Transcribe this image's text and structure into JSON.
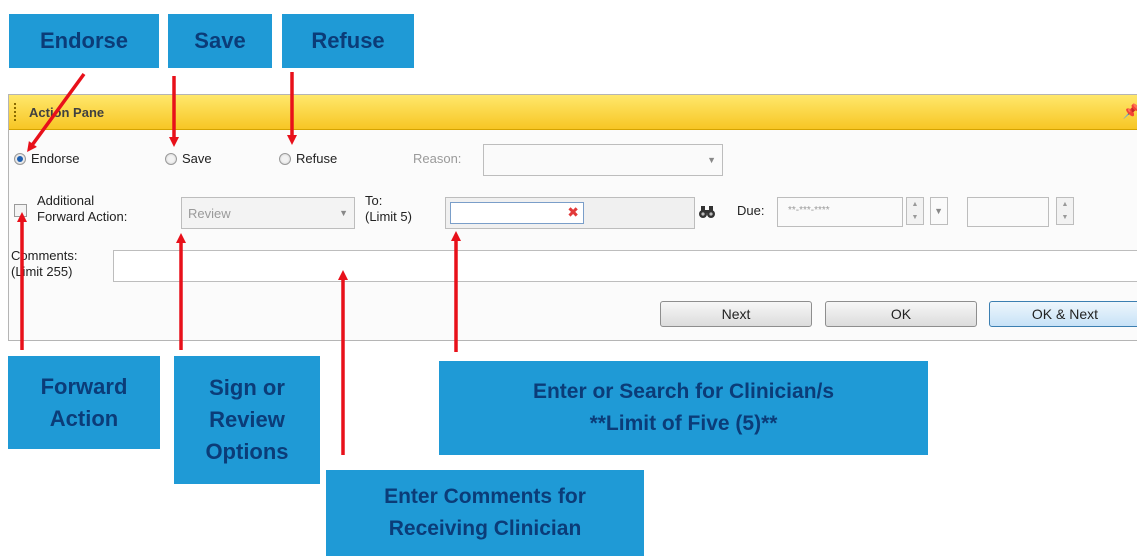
{
  "callouts": {
    "endorse": "Endorse",
    "save": "Save",
    "refuse": "Refuse",
    "forward_action": [
      "Forward",
      "Action"
    ],
    "sign_review": [
      "Sign or",
      "Review",
      "Options"
    ],
    "search_clinician": [
      "Enter or Search for Clinician/s",
      "**Limit of Five (5)**"
    ],
    "comments": [
      "Enter Comments for",
      "Receiving Clinician"
    ]
  },
  "pane": {
    "title": "Action Pane",
    "radios": {
      "endorse": "Endorse",
      "save": "Save",
      "refuse": "Refuse",
      "selected": "endorse"
    },
    "reason_label": "Reason:",
    "reason_value": "",
    "additional_label": [
      "Additional",
      "Forward Action:"
    ],
    "forward_action_value": "Review",
    "to_label": [
      "To:",
      "(Limit 5)"
    ],
    "to_value": "",
    "due_label": "Due:",
    "due_placeholder": "**-***-****",
    "comments_label": [
      "Comments:",
      "(Limit 255)"
    ],
    "comments_value": "",
    "buttons": {
      "next": "Next",
      "ok": "OK",
      "ok_next": "OK & Next"
    }
  },
  "colors": {
    "callout_bg": "#1f9ad6",
    "callout_text": "#0b3c78",
    "header_bg": "#f7c625",
    "arrow": "#e8101a"
  },
  "icons": {
    "pin": "pin-icon",
    "clear": "clear-x-icon",
    "binoculars": "binoculars-icon"
  }
}
